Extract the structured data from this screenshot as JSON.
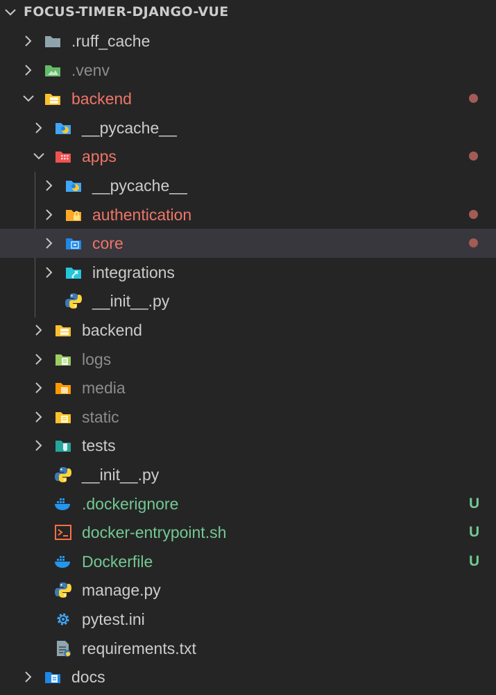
{
  "explorer": {
    "title": "FOCUS-TIMER-DJANGO-VUE",
    "items": [
      {
        "label": ".ruff_cache",
        "icon": "folder-gray-icon",
        "twisty": "closed",
        "level": 0,
        "state": "normal"
      },
      {
        "label": ".venv",
        "icon": "folder-environment-icon",
        "twisty": "closed",
        "level": 0,
        "state": "ignored"
      },
      {
        "label": "backend",
        "icon": "folder-server-icon",
        "twisty": "open",
        "level": 0,
        "state": "modified",
        "decoration": "dot"
      },
      {
        "label": "__pycache__",
        "icon": "folder-python-icon",
        "twisty": "closed",
        "level": 1,
        "state": "normal"
      },
      {
        "label": "apps",
        "icon": "folder-app-icon",
        "twisty": "open",
        "level": 1,
        "state": "modified",
        "decoration": "dot"
      },
      {
        "label": "__pycache__",
        "icon": "folder-python-icon",
        "twisty": "closed",
        "level": 2,
        "state": "normal"
      },
      {
        "label": "authentication",
        "icon": "folder-lock-icon",
        "twisty": "closed",
        "level": 2,
        "state": "modified",
        "decoration": "dot"
      },
      {
        "label": "core",
        "icon": "folder-core-icon",
        "twisty": "closed",
        "level": 2,
        "state": "modified",
        "decoration": "dot",
        "selected": true
      },
      {
        "label": "integrations",
        "icon": "folder-plugin-icon",
        "twisty": "closed",
        "level": 2,
        "state": "normal"
      },
      {
        "label": "__init__.py",
        "icon": "python-file-icon",
        "twisty": "none",
        "level": 2,
        "state": "normal"
      },
      {
        "label": "backend",
        "icon": "folder-server-icon",
        "twisty": "closed",
        "level": 1,
        "state": "normal"
      },
      {
        "label": "logs",
        "icon": "folder-logs-icon",
        "twisty": "closed",
        "level": 1,
        "state": "ignored"
      },
      {
        "label": "media",
        "icon": "folder-media-icon",
        "twisty": "closed",
        "level": 1,
        "state": "ignored"
      },
      {
        "label": "static",
        "icon": "folder-static-icon",
        "twisty": "closed",
        "level": 1,
        "state": "ignored"
      },
      {
        "label": "tests",
        "icon": "folder-test-icon",
        "twisty": "closed",
        "level": 1,
        "state": "normal"
      },
      {
        "label": "__init__.py",
        "icon": "python-file-icon",
        "twisty": "none",
        "level": 1,
        "state": "normal"
      },
      {
        "label": ".dockerignore",
        "icon": "docker-icon",
        "twisty": "none",
        "level": 1,
        "state": "untracked",
        "decoration": "U"
      },
      {
        "label": "docker-entrypoint.sh",
        "icon": "shell-script-icon",
        "twisty": "none",
        "level": 1,
        "state": "untracked",
        "decoration": "U"
      },
      {
        "label": "Dockerfile",
        "icon": "docker-icon",
        "twisty": "none",
        "level": 1,
        "state": "untracked",
        "decoration": "U"
      },
      {
        "label": "manage.py",
        "icon": "python-file-icon",
        "twisty": "none",
        "level": 1,
        "state": "normal"
      },
      {
        "label": "pytest.ini",
        "icon": "settings-gear-icon",
        "twisty": "none",
        "level": 1,
        "state": "normal"
      },
      {
        "label": "requirements.txt",
        "icon": "python-requirements-icon",
        "twisty": "none",
        "level": 1,
        "state": "normal"
      },
      {
        "label": "docs",
        "icon": "folder-docs-icon",
        "twisty": "closed",
        "level": 0,
        "state": "normal"
      }
    ]
  },
  "colors": {
    "background": "#252526",
    "selected_row": "#37373d",
    "modified_text": "#ef7567",
    "modified_dot": "#a35c55",
    "untracked_text": "#73c991",
    "ignored_text": "#8c8c8c",
    "normal_text": "#cccccc"
  }
}
